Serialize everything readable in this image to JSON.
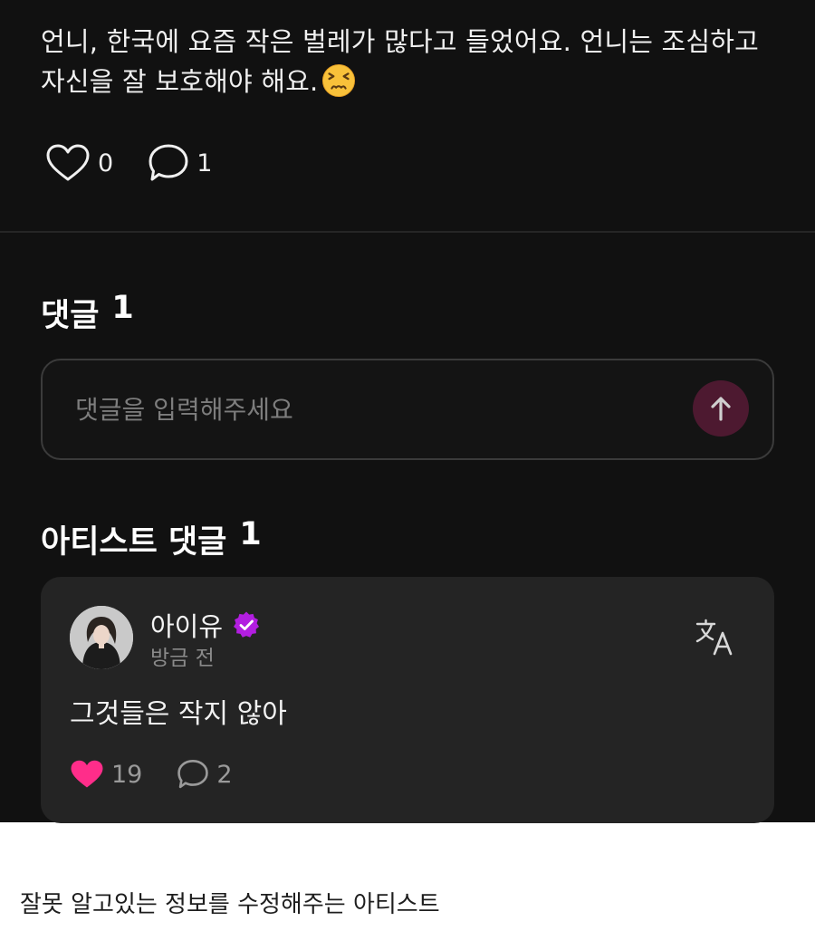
{
  "post": {
    "text": "언니, 한국에 요즘 작은 벌레가 많다고 들었어요. 언니는 조심하고 자신을 잘 보호해야 해요.",
    "emoji": "persevering-face-emoji",
    "like_count": "0",
    "comment_count": "1"
  },
  "comments_section": {
    "title": "댓글",
    "count": "1",
    "input_placeholder": "댓글을 입력해주세요"
  },
  "artist_comments": {
    "title": "아티스트 댓글",
    "count": "1",
    "comment": {
      "author": "아이유",
      "timestamp": "방금 전",
      "body": "그것들은 작지 않아",
      "like_count": "19",
      "reply_count": "2"
    }
  },
  "caption": "잘못 알고있는 정보를 수정해주는 아티스트",
  "colors": {
    "background": "#111111",
    "card": "#242424",
    "accent_pink": "#ff2d8a",
    "verified_purple": "#b21ee0",
    "send_button": "#4d1930"
  },
  "icons": [
    "heart-outline-icon",
    "comment-bubble-icon",
    "arrow-up-icon",
    "verified-badge-icon",
    "translate-icon",
    "heart-filled-icon"
  ]
}
